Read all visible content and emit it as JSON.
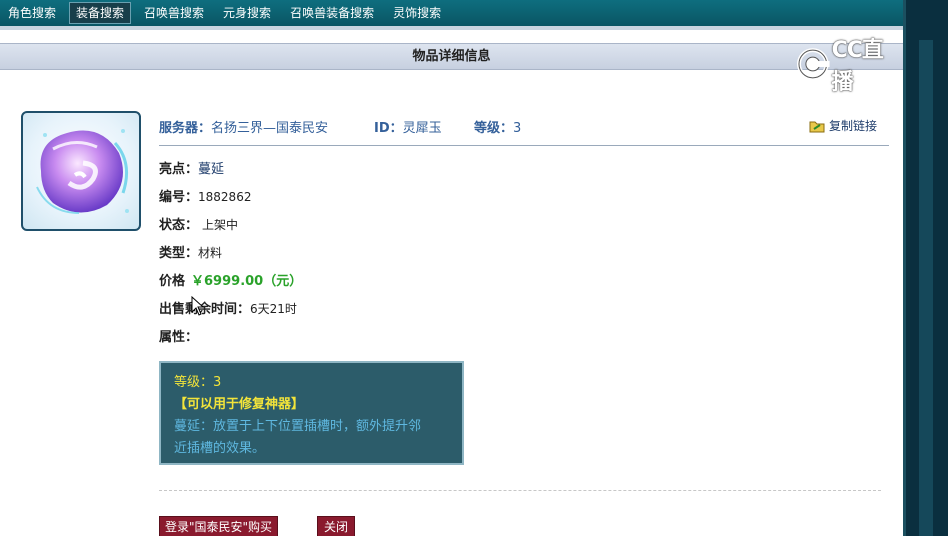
{
  "nav": {
    "tabs": [
      {
        "label": "角色搜索"
      },
      {
        "label": "装备搜索"
      },
      {
        "label": "召唤兽搜索"
      },
      {
        "label": "元身搜索"
      },
      {
        "label": "召唤兽装备搜索"
      },
      {
        "label": "灵饰搜索"
      }
    ],
    "active_index": 1
  },
  "header": {
    "title": "物品详细信息"
  },
  "watermark": {
    "text": "CC直播",
    "icon": "cc-live-logo-icon"
  },
  "item": {
    "image_icon": "crystal-material-icon",
    "server_label": "服务器：",
    "server_value": "名扬三界—国泰民安",
    "id_label": "ID：",
    "id_value": "灵犀玉",
    "level_label": "等级：",
    "level_value": "3",
    "copy_link_label": "复制链接",
    "fields": {
      "highlight_label": "亮点：",
      "highlight_value": "蔓延",
      "serial_label": "编号：",
      "serial_value": "1882862",
      "status_label": "状态：",
      "status_value": "上架中",
      "type_label": "类型：",
      "type_value": "材料",
      "price_label": "价格",
      "price_value": "￥6999.00（元）",
      "time_left_label": "出售剩余时间：",
      "time_left_value": "6天21时",
      "attributes_label": "属性："
    },
    "attributes": {
      "line1": "等级：3",
      "line2": "【可以用于修复神器】",
      "line3": "蔓延：放置于上下位置插槽时，额外提升邻",
      "line4": "近插槽的效果。"
    }
  },
  "buttons": {
    "login_buy": "登录\"国泰民安\"购买",
    "close": "关闭"
  },
  "colors": {
    "nav_bg": "#0e6e7f",
    "price": "#2aa22a",
    "button": "#8a1a2e",
    "attr_box_bg": "#2c5c6a",
    "attr_yellow": "#f2e43a",
    "attr_blue": "#5fb8e0",
    "info_blue": "#34609a"
  }
}
